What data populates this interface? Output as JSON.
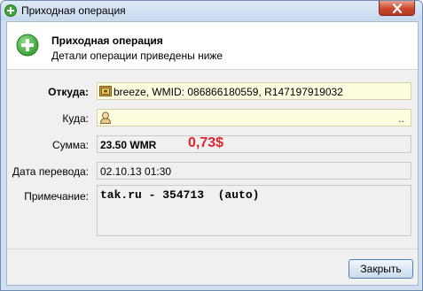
{
  "window": {
    "title": "Приходная операция"
  },
  "header": {
    "title": "Приходная операция",
    "subtitle": "Детали операции приведены ниже"
  },
  "fields": {
    "from": {
      "label": "Откуда:",
      "value": "breeze, WMID: 086866180559, R147197919032"
    },
    "to": {
      "label": "Куда:",
      "value": "",
      "trailing": ".."
    },
    "amount": {
      "label": "Сумма:",
      "value": "23.50 WMR",
      "annotation": "0,73$"
    },
    "date": {
      "label": "Дата перевода:",
      "value": "02.10.13 01:30"
    },
    "note": {
      "label": "Примечание:",
      "value": "tak.ru - 354713  (auto)"
    }
  },
  "buttons": {
    "close_label": "Закрыть"
  },
  "icons": {
    "title_icon": "plus-circle-icon",
    "header_icon": "plus-circle-icon",
    "from_icon": "wallet-icon",
    "to_icon": "user-icon",
    "close_icon": "close-icon"
  },
  "colors": {
    "accent_green": "#3ea53a",
    "annotation_red": "#e0242f",
    "field_yellow": "#fffde0"
  }
}
